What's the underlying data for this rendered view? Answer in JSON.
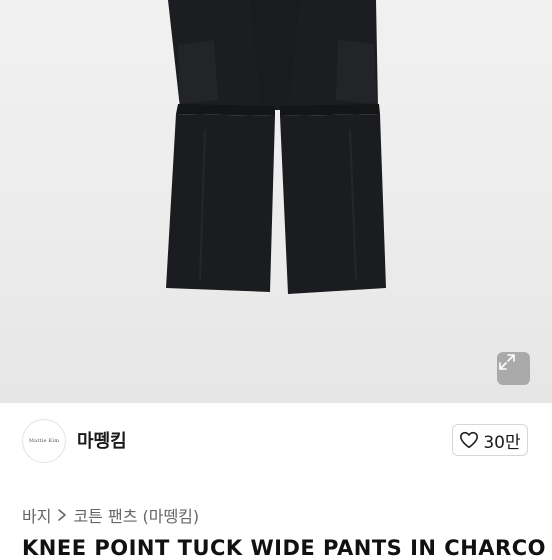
{
  "product": {
    "image_alt": "black wide cargo pants",
    "expand_icon": "expand-icon"
  },
  "seller": {
    "avatar_text": "Mattie Kim",
    "name": "마뗑킴"
  },
  "like": {
    "icon": "heart-icon",
    "count": "30만"
  },
  "breadcrumb": {
    "items": [
      "바지",
      "코튼 팬츠 (마뗑킴)"
    ],
    "separator_icon": "chevron-right-icon"
  },
  "title": "KNEE POINT TUCK WIDE PANTS IN CHARCO"
}
